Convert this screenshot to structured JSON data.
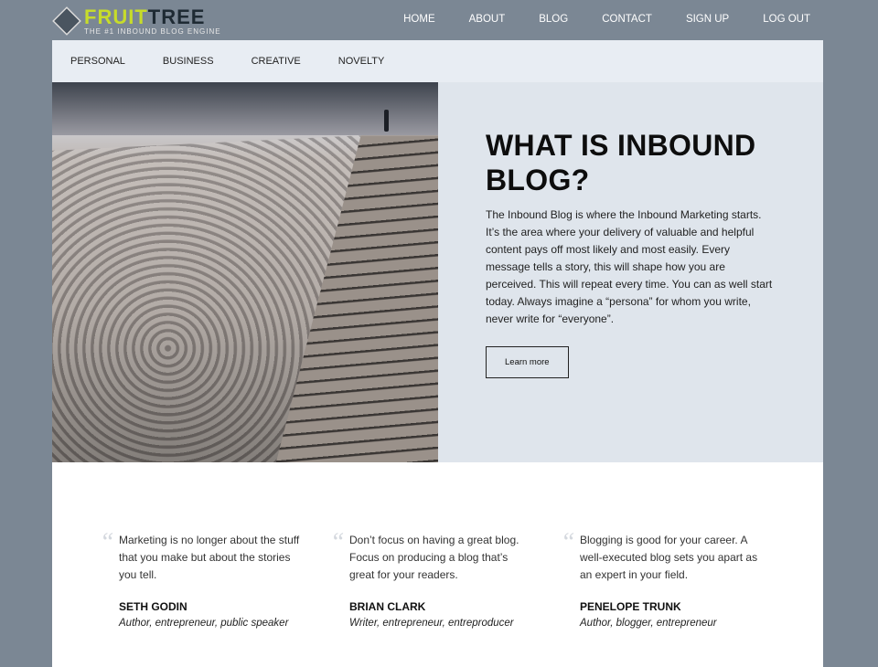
{
  "logo": {
    "brand_part1": "FRUIT",
    "brand_part2": "TREE",
    "tagline": "THE #1 INBOUND BLOG ENGINE"
  },
  "main_nav": [
    "HOME",
    "ABOUT",
    "BLOG",
    "CONTACT",
    "SIGN UP",
    "LOG OUT"
  ],
  "sub_nav": [
    "PERSONAL",
    "BUSINESS",
    "CREATIVE",
    "NOVELTY"
  ],
  "hero": {
    "title": "WHAT IS INBOUND BLOG?",
    "body": "The Inbound Blog is where the Inbound Marketing starts. It’s the area where your delivery of valuable and helpful content pays off most likely and most easily. Every message tells a story, this will shape how you are perceived. This will repeat every time. You can as well start today. Always imagine a “persona” for whom you write, never write for “everyone”.",
    "button": "Learn more"
  },
  "quotes": [
    {
      "text": "Marketing is no longer about the stuff that you make but about the stories you tell.",
      "name": "SETH GODIN",
      "role": "Author, entrepreneur, public speaker"
    },
    {
      "text": "Don’t focus on having a great blog. Focus on producing a blog that’s great for your readers.",
      "name": "BRIAN CLARK",
      "role": "Writer, entrepreneur, entreproducer"
    },
    {
      "text": "Blogging is good for your career. A well-executed blog sets you apart as an expert in your field.",
      "name": "PENELOPE TRUNK",
      "role": "Author, blogger, entrepreneur"
    }
  ]
}
